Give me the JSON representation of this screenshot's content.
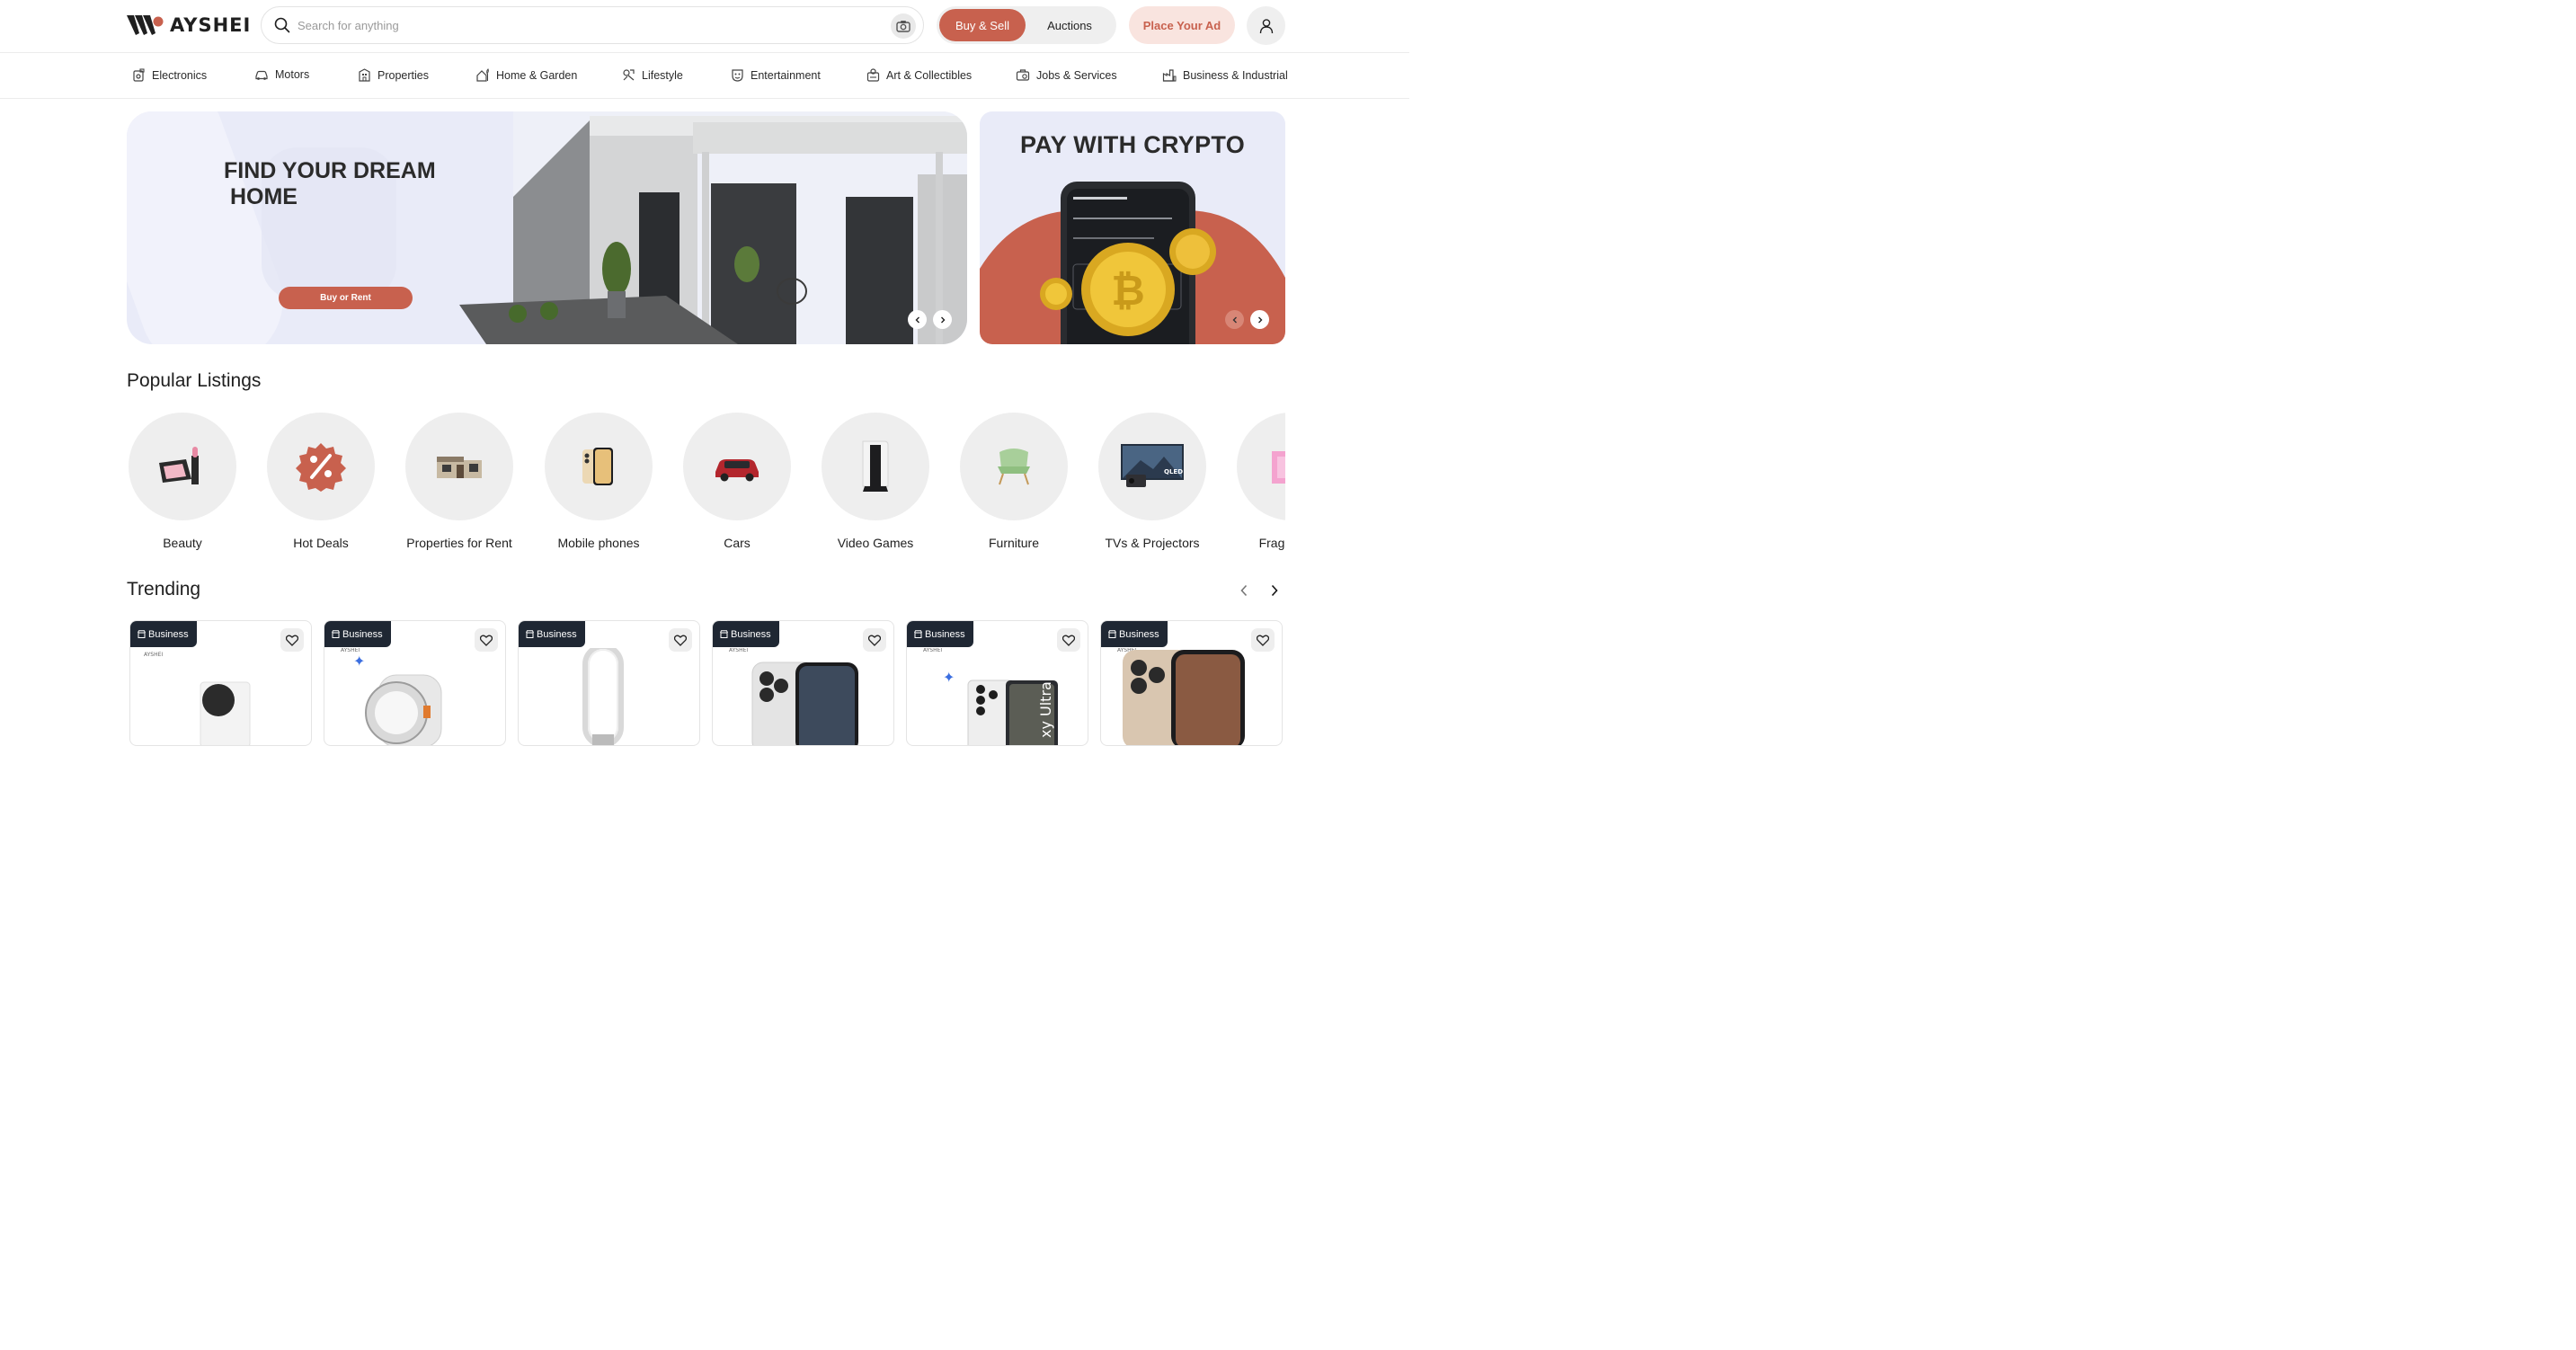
{
  "header": {
    "logo_text": "AYSHEI",
    "search_placeholder": "Search for anything",
    "toggle": {
      "active": "Buy & Sell",
      "inactive": "Auctions"
    },
    "place_ad": "Place Your Ad"
  },
  "categories": [
    {
      "label": "Electronics",
      "icon": "electronics-icon"
    },
    {
      "label": "Motors",
      "icon": "car-icon"
    },
    {
      "label": "Properties",
      "icon": "building-icon"
    },
    {
      "label": "Home & Garden",
      "icon": "home-garden-icon"
    },
    {
      "label": "Lifestyle",
      "icon": "lifestyle-icon"
    },
    {
      "label": "Entertainment",
      "icon": "entertainment-icon"
    },
    {
      "label": "Art & Collectibles",
      "icon": "art-icon"
    },
    {
      "label": "Jobs & Services",
      "icon": "jobs-icon"
    },
    {
      "label": "Business & Industrial",
      "icon": "business-icon"
    }
  ],
  "hero": {
    "title": "FIND YOUR DREAM\n HOME",
    "cta": "Buy or Rent"
  },
  "crypto": {
    "title": "PAY WITH CRYPTO"
  },
  "popular": {
    "title": "Popular Listings",
    "items": [
      {
        "label": "Beauty",
        "icon": "makeup-icon"
      },
      {
        "label": "Hot Deals",
        "icon": "discount-badge-icon"
      },
      {
        "label": "Properties for Rent",
        "icon": "house-icon"
      },
      {
        "label": "Mobile phones",
        "icon": "phone-icon"
      },
      {
        "label": "Cars",
        "icon": "car-icon"
      },
      {
        "label": "Video Games",
        "icon": "console-icon"
      },
      {
        "label": "Furniture",
        "icon": "chair-icon"
      },
      {
        "label": "TVs & Projectors",
        "icon": "tv-icon"
      },
      {
        "label": "Fragrances",
        "icon": "fragrance-icon"
      }
    ]
  },
  "trending": {
    "title": "Trending",
    "cards": [
      {
        "badge": "Business",
        "product": "xbox-series-s"
      },
      {
        "badge": "Business",
        "product": "smartwatch"
      },
      {
        "badge": "Business",
        "product": "dyson-fan"
      },
      {
        "badge": "Business",
        "product": "iphone-pro"
      },
      {
        "badge": "Business",
        "product": "galaxy-ultra"
      },
      {
        "badge": "Business",
        "product": "iphone-pro-desert"
      }
    ]
  },
  "colors": {
    "accent": "#c8614e",
    "accent_soft": "#f9e4df",
    "badge": "#1f2733",
    "banner_bg": "#e9ebf8"
  }
}
